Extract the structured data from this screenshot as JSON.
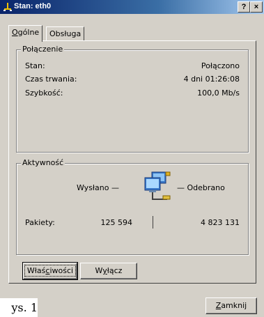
{
  "window": {
    "title": "Stan: eth0",
    "help_label": "?",
    "close_label": "×"
  },
  "tabs": [
    {
      "label_prefix": "",
      "label_mnemonic": "O",
      "label_rest": "gólne",
      "active": true
    },
    {
      "label_prefix": "",
      "label_mnemonic": "",
      "label_rest": "Obsługa",
      "active": false
    }
  ],
  "connection": {
    "group_label": "Połączenie",
    "rows": [
      {
        "label": "Stan:",
        "value": "Połączono"
      },
      {
        "label": "Czas trwania:",
        "value": "4 dni 01:26:08"
      },
      {
        "label": "Szybkość:",
        "value": "100,0 Mb/s"
      }
    ]
  },
  "activity": {
    "group_label": "Aktywność",
    "sent_label": "Wysłano —",
    "received_label": "— Odebrano",
    "packets_label": "Pakiety:",
    "packets_sent": "125 594",
    "packets_received": "4 823 131",
    "icon": "network-computers-icon"
  },
  "buttons": {
    "properties": {
      "prefix": "Właś",
      "mnemonic": "c",
      "rest": "iwości"
    },
    "disable": {
      "prefix": "W",
      "mnemonic": "y",
      "rest": "łącz"
    },
    "close": {
      "prefix": "",
      "mnemonic": "Z",
      "rest": "amknij"
    }
  },
  "caption": "ys. 1",
  "colors": {
    "face": "#d4d0c8",
    "title_start": "#0a246a",
    "title_end": "#a6caf0"
  }
}
